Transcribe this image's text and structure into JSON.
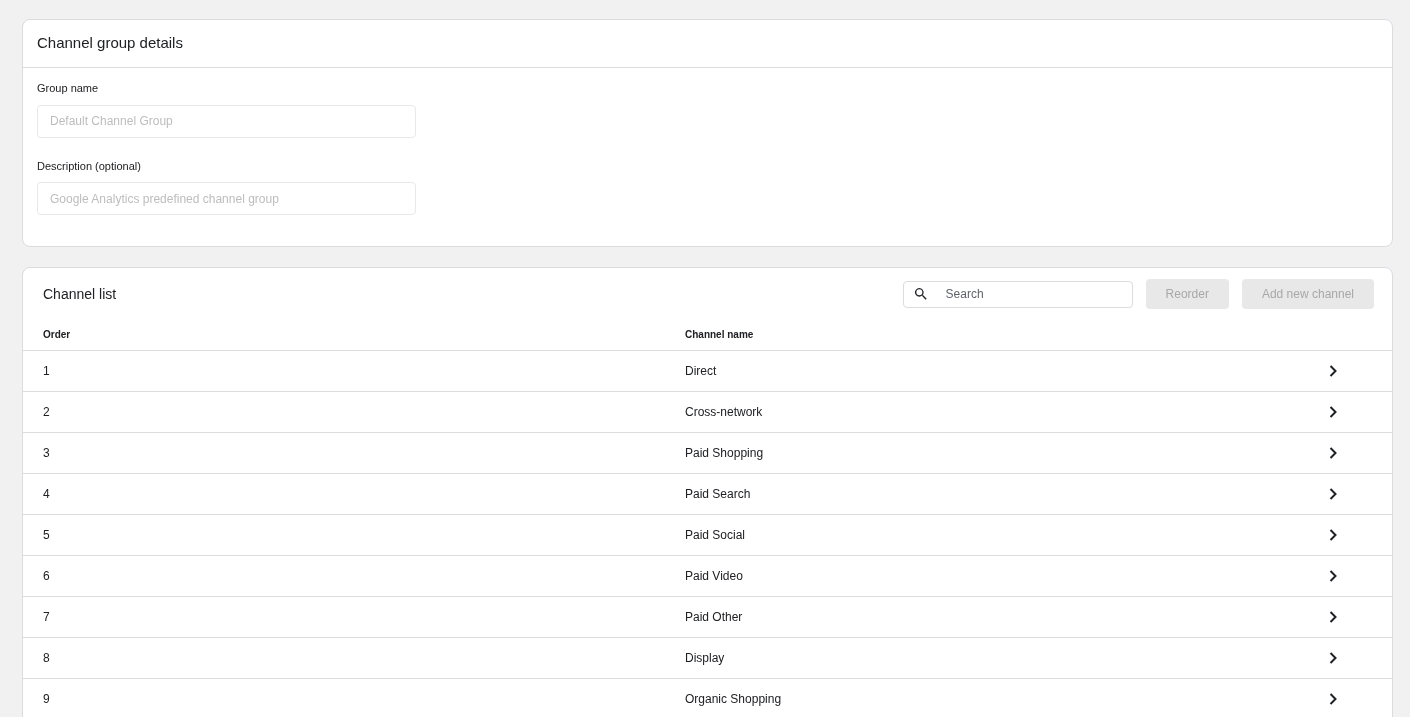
{
  "details": {
    "title": "Channel group details",
    "fields": [
      {
        "label": "Group name",
        "placeholder": "Default Channel Group"
      },
      {
        "label": "Description (optional)",
        "placeholder": "Google Analytics predefined channel group"
      }
    ]
  },
  "channel_list": {
    "title": "Channel list",
    "search": {
      "placeholder": "Search"
    },
    "buttons": [
      {
        "label": "Reorder",
        "disabled": true
      },
      {
        "label": "Add new channel",
        "disabled": true
      }
    ],
    "columns": [
      "Order",
      "Channel name"
    ],
    "rows": [
      {
        "order": "1",
        "name": "Direct"
      },
      {
        "order": "2",
        "name": "Cross-network"
      },
      {
        "order": "3",
        "name": "Paid Shopping"
      },
      {
        "order": "4",
        "name": "Paid Search"
      },
      {
        "order": "5",
        "name": "Paid Social"
      },
      {
        "order": "6",
        "name": "Paid Video"
      },
      {
        "order": "7",
        "name": "Paid Other"
      },
      {
        "order": "8",
        "name": "Display"
      },
      {
        "order": "9",
        "name": "Organic Shopping"
      }
    ]
  }
}
